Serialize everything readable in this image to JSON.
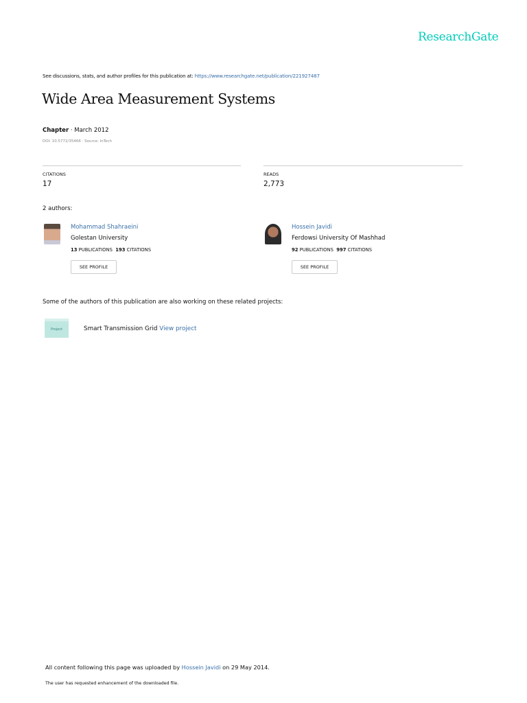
{
  "brand": "ResearchGate",
  "header": {
    "see_text": "See discussions, stats, and author profiles for this publication at: ",
    "url": "https://www.researchgate.net/publication/221927487"
  },
  "publication": {
    "title": "Wide Area Measurement Systems",
    "type": "Chapter",
    "date": " · March 2012",
    "doi_source": "DOI: 10.5772/35466 · Source: InTech"
  },
  "stats": {
    "citations_label": "CITATIONS",
    "citations": "17",
    "reads_label": "READS",
    "reads": "2,773"
  },
  "authors_heading": "2 authors:",
  "authors": [
    {
      "name": "Mohammad Shahraeini",
      "affiliation": "Golestan University",
      "pubs": "13",
      "pubs_label": " PUBLICATIONS",
      "cites": "193",
      "cites_label": " CITATIONS",
      "button": "SEE PROFILE"
    },
    {
      "name": "Hossein Javidi",
      "affiliation": "Ferdowsi University Of Mashhad",
      "pubs": "92",
      "pubs_label": " PUBLICATIONS",
      "cites": "997",
      "cites_label": " CITATIONS",
      "button": "SEE PROFILE"
    }
  ],
  "related": {
    "heading": "Some of the authors of this publication are also working on these related projects:",
    "icon_label": "Project",
    "project": "Smart Transmission Grid ",
    "link": "View project"
  },
  "footer": {
    "prefix": "All content following this page was uploaded by ",
    "uploader": "Hossein Javidi",
    "suffix": " on 29 May 2014.",
    "note": "The user has requested enhancement of the downloaded file."
  }
}
